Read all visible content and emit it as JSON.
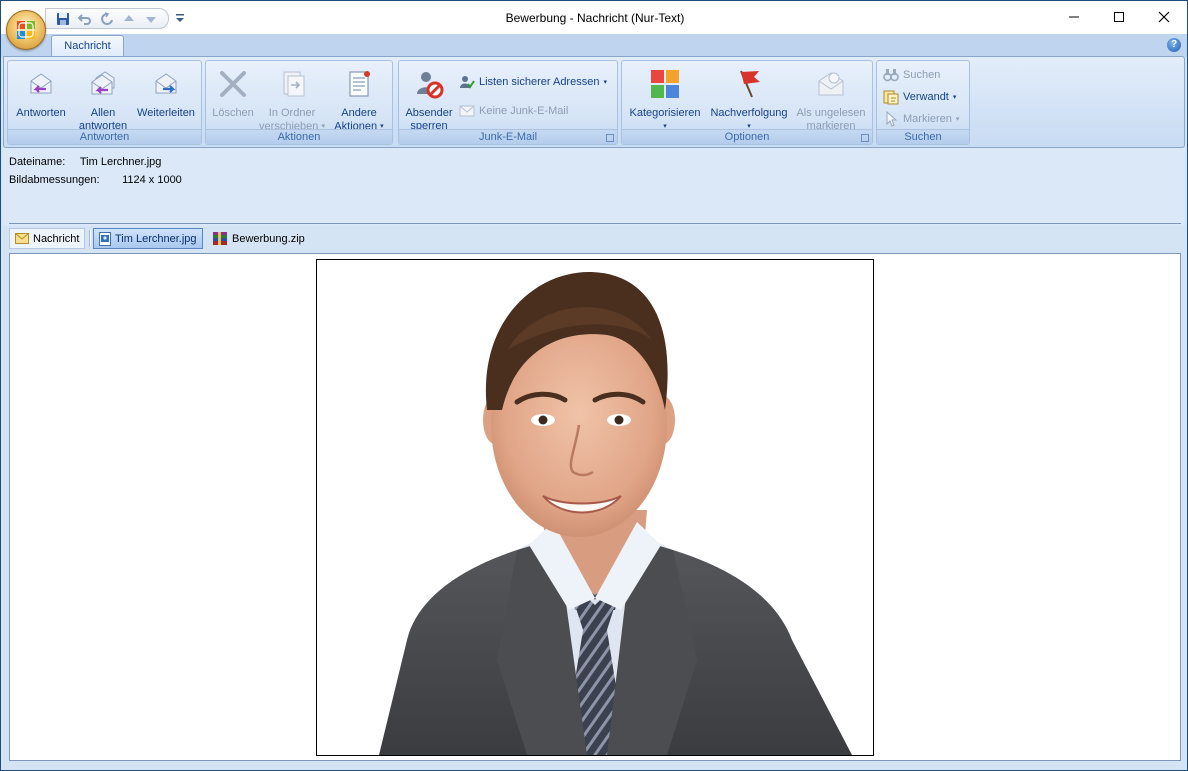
{
  "window": {
    "title": "Bewerbung - Nachricht (Nur-Text)",
    "controls": [
      "minimize",
      "maximize",
      "close"
    ]
  },
  "quick_access": {
    "items": [
      "save-icon",
      "undo-icon",
      "redo-icon",
      "previous-item-icon",
      "next-item-icon"
    ]
  },
  "tabs": [
    {
      "label": "Nachricht",
      "selected": true
    }
  ],
  "ribbon": {
    "groups": [
      {
        "label": "Antworten",
        "buttons": [
          {
            "label": "Antworten"
          },
          {
            "label_line1": "Allen",
            "label_line2": "antworten"
          },
          {
            "label": "Weiterleiten"
          }
        ]
      },
      {
        "label": "Aktionen",
        "buttons": [
          {
            "label": "Löschen",
            "enabled": false
          },
          {
            "label_line1": "In Ordner",
            "label_line2": "verschieben",
            "enabled": false
          },
          {
            "label_line1": "Andere",
            "label_line2": "Aktionen"
          }
        ]
      },
      {
        "label": "Junk-E-Mail",
        "buttons": [
          {
            "label_line1": "Absender",
            "label_line2": "sperren"
          },
          {
            "label": "Listen sicherer Adressen"
          },
          {
            "label": "Keine Junk-E-Mail",
            "enabled": false
          }
        ]
      },
      {
        "label": "Optionen",
        "buttons": [
          {
            "label": "Kategorisieren"
          },
          {
            "label": "Nachverfolgung"
          },
          {
            "label_line1": "Als ungelesen",
            "label_line2": "markieren",
            "enabled": false
          }
        ]
      },
      {
        "label": "Suchen",
        "buttons": [
          {
            "label": "Suchen",
            "enabled": false
          },
          {
            "label": "Verwandt"
          },
          {
            "label": "Markieren",
            "enabled": false
          }
        ]
      }
    ]
  },
  "file_info": {
    "name_label": "Dateiname:",
    "name_value": "Tim Lerchner.jpg",
    "size_label": "Bildabmessungen:",
    "size_value": "1124 x 1000"
  },
  "attachments": [
    {
      "label": "Nachricht",
      "icon": "envelope-icon",
      "selected": false
    },
    {
      "label": "Tim Lerchner.jpg",
      "icon": "image-file-icon",
      "selected": true
    },
    {
      "label": "Bewerbung.zip",
      "icon": "zip-archive-icon",
      "selected": false
    }
  ],
  "colors": {
    "ribbon_text": "#15428b",
    "group_label": "#3e6aaa",
    "suit": "#4a4b4f",
    "shirt": "#dfe6f2"
  }
}
